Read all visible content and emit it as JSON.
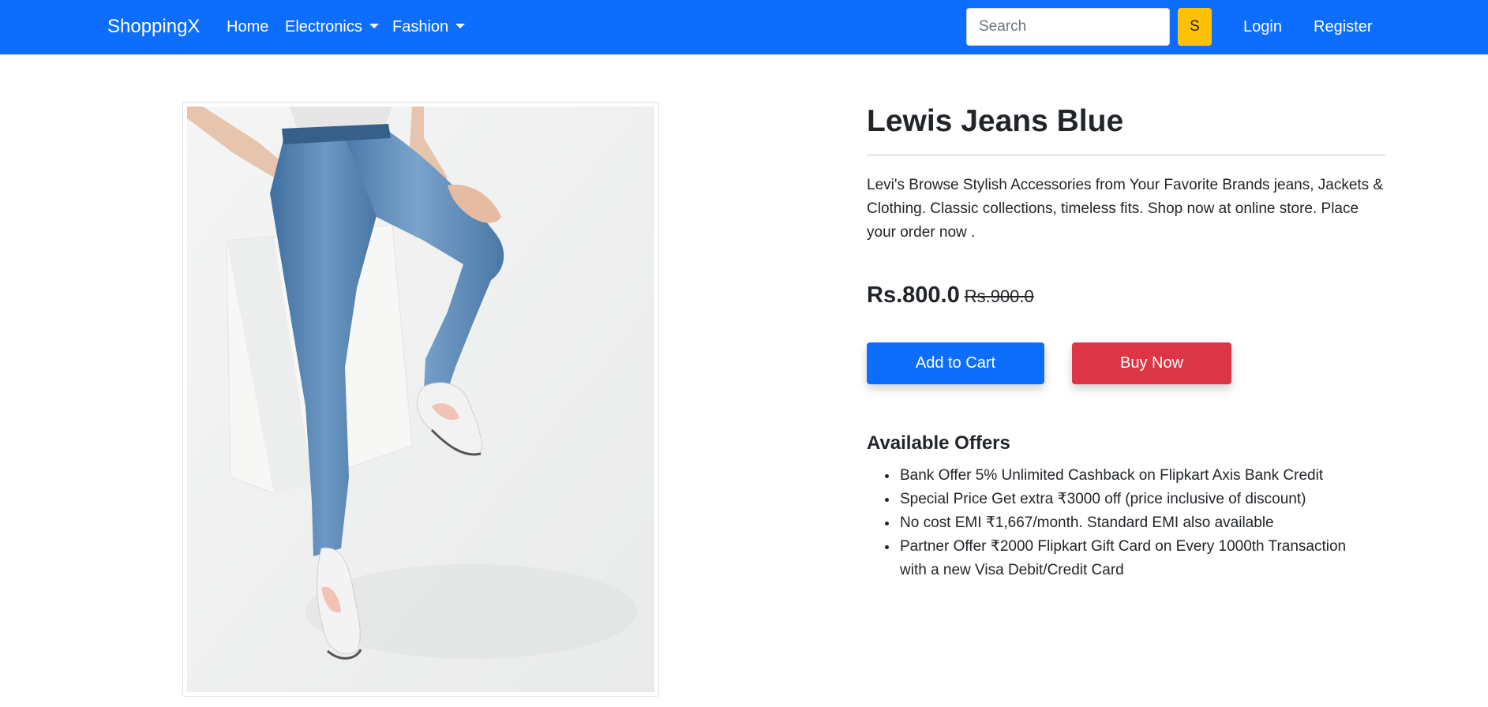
{
  "navbar": {
    "brand": "ShoppingX",
    "links": [
      {
        "label": "Home"
      },
      {
        "label": "Electronics"
      },
      {
        "label": "Fashion"
      }
    ],
    "search_placeholder": "Search",
    "search_button": "S",
    "login": "Login",
    "register": "Register",
    "colors": {
      "bar": "#0d6efd",
      "search_button": "#ffc107"
    }
  },
  "product": {
    "title": "Lewis Jeans Blue",
    "description": "Levi's Browse Stylish Accessories from Your Favorite Brands jeans, Jackets & Clothing. Classic collections, timeless fits. Shop now at online store. Place your order now .",
    "price": "Rs.800.0",
    "old_price": "Rs.900.0",
    "image_icon": "product-photo-jeans"
  },
  "actions": {
    "add_to_cart": "Add to Cart",
    "buy_now": "Buy Now",
    "colors": {
      "add_to_cart": "#0d6efd",
      "buy_now": "#dc3545"
    }
  },
  "offers": {
    "title": "Available Offers",
    "items": [
      "Bank Offer 5% Unlimited Cashback on Flipkart Axis Bank Credit",
      "Special Price Get extra ₹3000 off (price inclusive of discount)",
      "No cost EMI ₹1,667/month. Standard EMI also available",
      "Partner Offer ₹2000 Flipkart Gift Card on Every 1000th Transaction with a new Visa Debit/Credit Card"
    ]
  }
}
